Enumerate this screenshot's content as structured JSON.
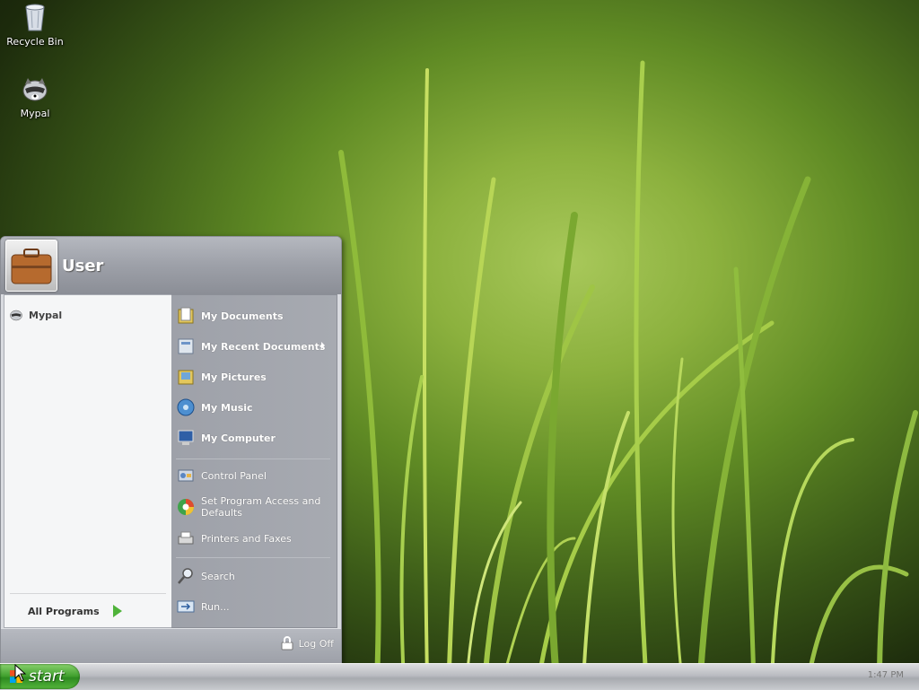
{
  "desktop": {
    "icons": [
      {
        "label": "Recycle Bin",
        "icon": "recycle-bin-icon"
      },
      {
        "label": "Mypal",
        "icon": "raccoon-icon"
      }
    ]
  },
  "start_menu": {
    "user_name": "User",
    "pinned": [
      {
        "label": "Mypal",
        "icon": "raccoon-icon"
      }
    ],
    "all_programs_label": "All Programs",
    "right_items": [
      {
        "label": "My Documents",
        "icon": "documents-folder-icon"
      },
      {
        "label": "My Recent Documents",
        "icon": "recent-documents-icon"
      },
      {
        "label": "My Pictures",
        "icon": "pictures-folder-icon"
      },
      {
        "label": "My Music",
        "icon": "music-folder-icon"
      },
      {
        "label": "My Computer",
        "icon": "computer-icon"
      },
      {
        "label": "Control Panel",
        "icon": "control-panel-icon"
      },
      {
        "label": "Set Program Access and Defaults",
        "icon": "program-access-icon"
      },
      {
        "label": "Printers and Faxes",
        "icon": "printer-icon"
      },
      {
        "label": "Search",
        "icon": "search-icon"
      },
      {
        "label": "Run...",
        "icon": "run-icon"
      }
    ],
    "log_off_label": "Log Off"
  },
  "taskbar": {
    "start_label": "start",
    "clock": "1:47 PM"
  },
  "colors": {
    "start_green": "#3e9e2c",
    "menu_right_panel": "#a0a3aa"
  }
}
